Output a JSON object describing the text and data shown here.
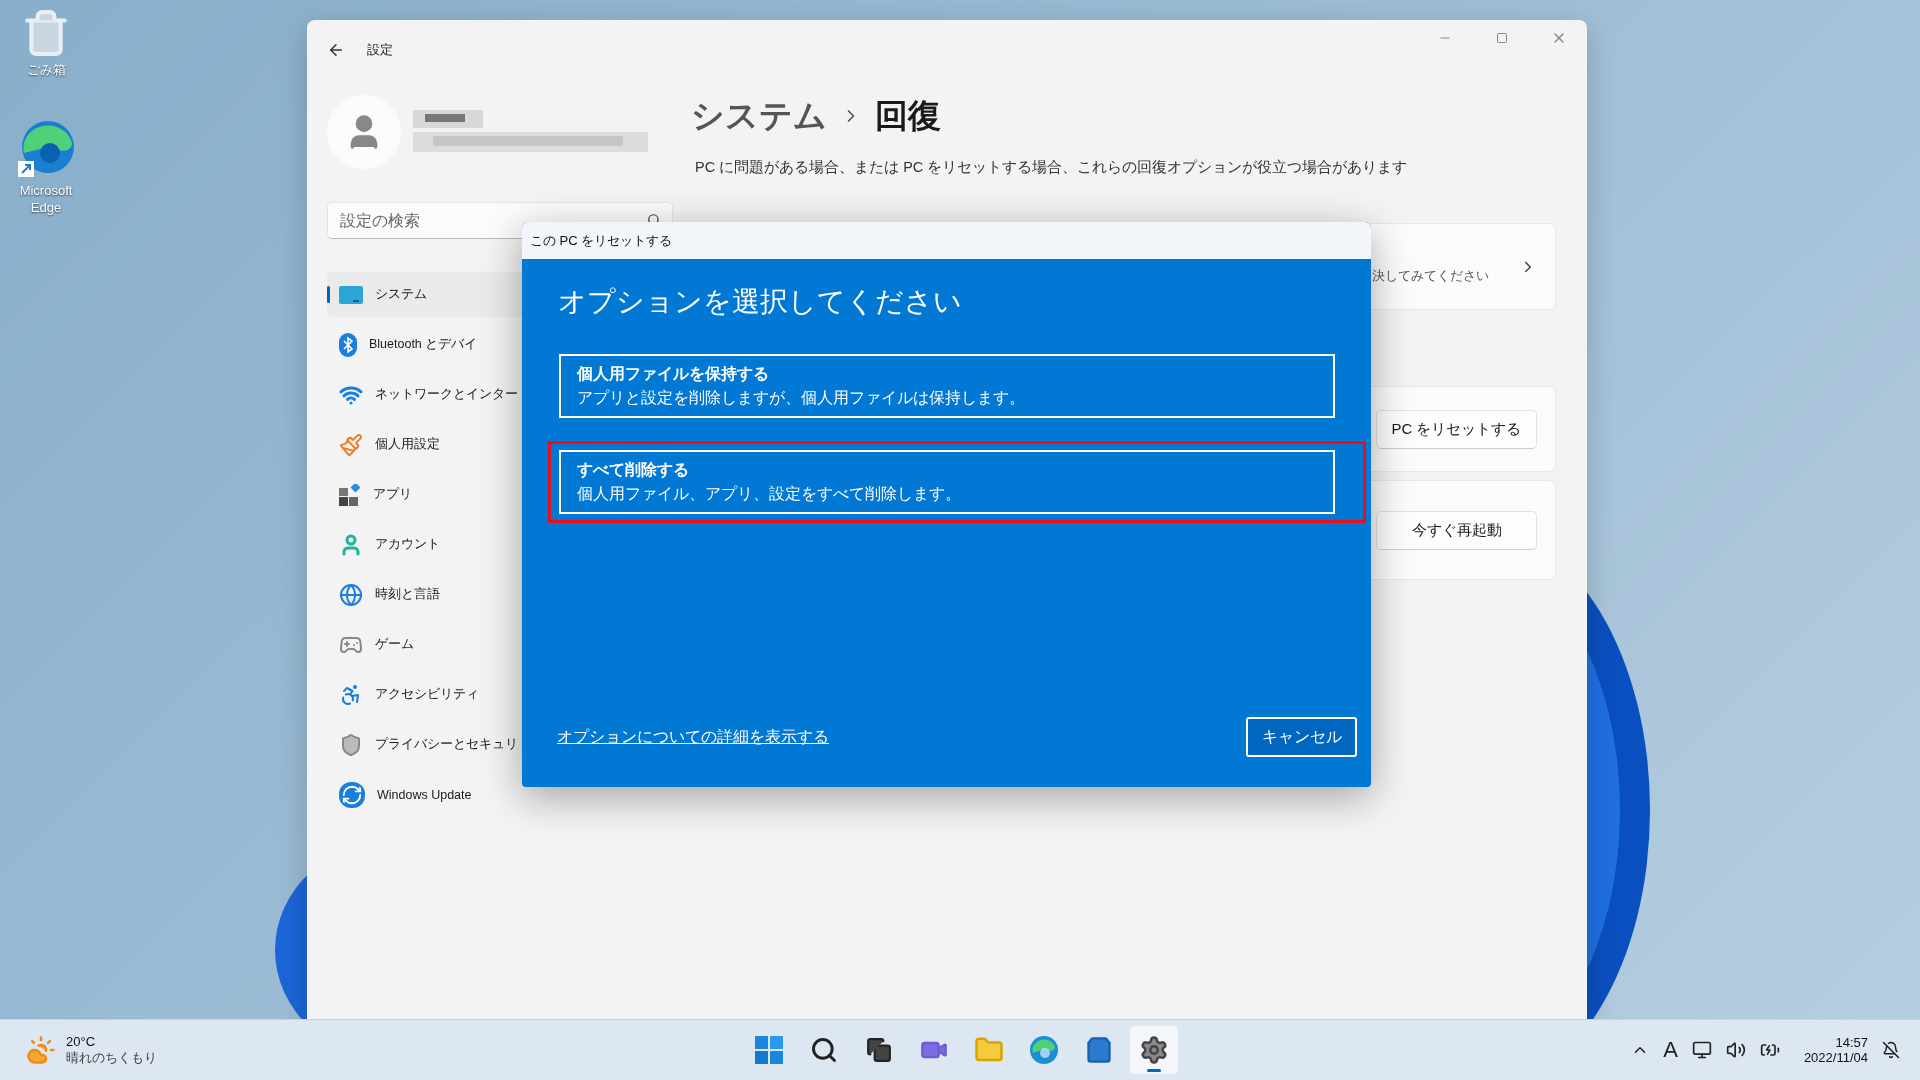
{
  "desktop_icons": [
    {
      "label": "ごみ箱",
      "kind": "recycle_bin"
    },
    {
      "label": "Microsoft Edge",
      "kind": "edge"
    }
  ],
  "window": {
    "title": "設定",
    "breadcrumb_parent": "システム",
    "breadcrumb_current": "回復",
    "description": "PC に問題がある場合、または PC をリセットする場合、これらの回復オプションが役立つ場合があります"
  },
  "search": {
    "placeholder": "設定の検索"
  },
  "sidebar": {
    "items": [
      {
        "label": "システム",
        "kind": "system",
        "selected": true
      },
      {
        "label": "Bluetooth とデバイ",
        "kind": "bluetooth",
        "selected": false
      },
      {
        "label": "ネットワークとインター",
        "kind": "wifi",
        "selected": false
      },
      {
        "label": "個人用設定",
        "kind": "brush",
        "selected": false
      },
      {
        "label": "アプリ",
        "kind": "apps",
        "selected": false
      },
      {
        "label": "アカウント",
        "kind": "account",
        "selected": false
      },
      {
        "label": "時刻と言語",
        "kind": "globe",
        "selected": false
      },
      {
        "label": "ゲーム",
        "kind": "game",
        "selected": false
      },
      {
        "label": "アクセシビリティ",
        "kind": "accessibility",
        "selected": false
      },
      {
        "label": "プライバシーとセキュリ",
        "kind": "shield",
        "selected": false
      },
      {
        "label": "Windows Update",
        "kind": "update",
        "selected": false
      }
    ]
  },
  "cards": [
    {
      "kind": "link",
      "text": "決してみてください"
    },
    {
      "kind": "button",
      "text": "PC をリセットする"
    },
    {
      "kind": "button",
      "text": "今すぐ再起動"
    }
  ],
  "dialog": {
    "title": "この PC をリセットする",
    "heading": "オプションを選択してください",
    "options": [
      {
        "title": "個人用ファイルを保持する",
        "description": "アプリと設定を削除しますが、個人用ファイルは保持します。",
        "highlighted": false
      },
      {
        "title": "すべて削除する",
        "description": "個人用ファイル、アプリ、設定をすべて削除します。",
        "highlighted": true
      }
    ],
    "link": "オプションについての詳細を表示する",
    "cancel": "キャンセル"
  },
  "taskbar": {
    "weather": {
      "temperature": "20°C",
      "condition": "晴れのちくもり"
    },
    "apps": [
      {
        "kind": "start",
        "active": false
      },
      {
        "kind": "search",
        "active": false
      },
      {
        "kind": "taskview",
        "active": false
      },
      {
        "kind": "chat",
        "active": false
      },
      {
        "kind": "explorer",
        "active": false
      },
      {
        "kind": "edge",
        "active": false
      },
      {
        "kind": "store",
        "active": false
      },
      {
        "kind": "settings",
        "active": true
      }
    ],
    "ime": "A",
    "time": "14:57",
    "date": "2022/11/04"
  }
}
